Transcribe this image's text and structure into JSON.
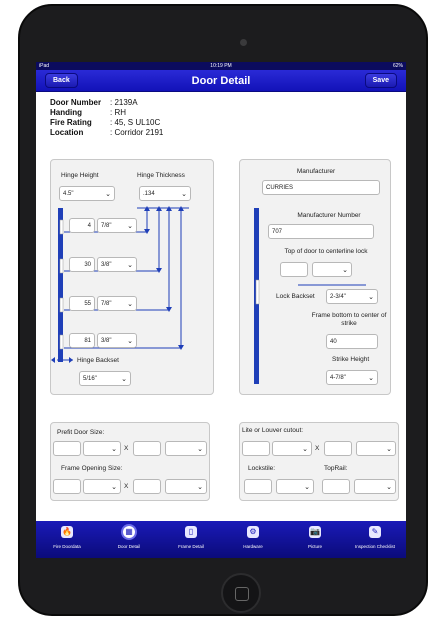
{
  "status_bar": {
    "carrier": "iPad",
    "time": "10:19 PM",
    "battery": "62%"
  },
  "nav": {
    "back": "Back",
    "title": "Door Detail",
    "save": "Save"
  },
  "door_info": [
    {
      "label": "Door Number",
      "value": ": 2139A"
    },
    {
      "label": "Handing",
      "value": ": RH"
    },
    {
      "label": "Fire Rating",
      "value": ": 45, S UL10C"
    },
    {
      "label": "Location",
      "value": ": Corridor 2191"
    }
  ],
  "hinge": {
    "height_label": "Hinge Height",
    "height_value": "4.5\"",
    "thickness_label": "Hinge Thickness",
    "thickness_value": ".134",
    "rows": [
      {
        "whole": "4",
        "fraction": "7/8\""
      },
      {
        "whole": "30",
        "fraction": "3/8\""
      },
      {
        "whole": "55",
        "fraction": "7/8\""
      },
      {
        "whole": "81",
        "fraction": "3/8\""
      }
    ],
    "backset_label": "Hinge Backset",
    "backset_value": "5/16\""
  },
  "manufacturer": {
    "label": "Manufacturer",
    "value": "CURRIES",
    "number_label": "Manufacturer Number",
    "number_value": "707",
    "top_label": "Top of door to centerline lock",
    "lock_backset_label": "Lock Backset",
    "lock_backset_value": "2-3/4\"",
    "strike_center_label": "Frame bottom to center of strike",
    "strike_center_value": "40",
    "strike_height_label": "Strike Height",
    "strike_height_value": "4-7/8\""
  },
  "sizes": {
    "prefit_label": "Prefit Door Size:",
    "frame_label": "Frame Opening Size:",
    "x": "X"
  },
  "lite": {
    "label": "Lite or Louver cutout:",
    "x": "X",
    "lockstile_label": "Lockstile:",
    "toprail_label": "TopRail:"
  },
  "tabs": [
    {
      "label": "Fire Doordata",
      "icon": "flame-icon",
      "glyph": "🔥",
      "active": false
    },
    {
      "label": "Door Detail",
      "icon": "door-detail-icon",
      "glyph": "▦",
      "active": true
    },
    {
      "label": "Frame Detail",
      "icon": "frame-icon",
      "glyph": "▯",
      "active": false
    },
    {
      "label": "Hardware",
      "icon": "hardware-icon",
      "glyph": "⚙",
      "active": false
    },
    {
      "label": "Picture",
      "icon": "camera-icon",
      "glyph": "📷",
      "active": false
    },
    {
      "label": "Inspection Checklist",
      "icon": "checklist-icon",
      "glyph": "✎",
      "active": false
    }
  ],
  "colors": {
    "nav_blue": "#1a1ac8",
    "rail_blue": "#1f3fb8",
    "tab_blue": "#0b0b7a"
  }
}
